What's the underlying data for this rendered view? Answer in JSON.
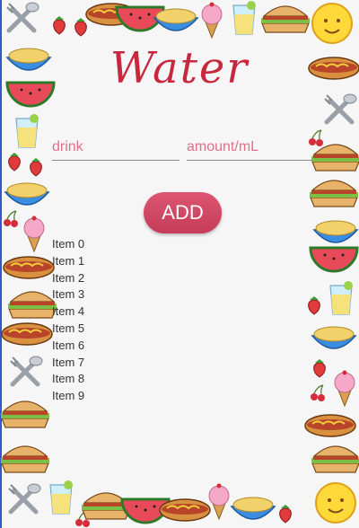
{
  "app": {
    "title": "Water"
  },
  "form": {
    "drink_placeholder": "drink",
    "amount_placeholder": "amount/mL",
    "add_label": "ADD"
  },
  "items": [
    "Item 0",
    "Item 1",
    "Item 2",
    "Item 3",
    "Item 4",
    "Item 5",
    "Item 6",
    "Item 7",
    "Item 8",
    "Item 9"
  ],
  "colors": {
    "accent": "#d24a66",
    "title": "#c8283e",
    "placeholder": "#e0708a",
    "background": "#f6f6f6"
  },
  "decor": {
    "border_icons": [
      "ice-cream-icon",
      "hot-dog-icon",
      "sandwich-icon",
      "watermelon-icon",
      "cereal-bowl-icon",
      "juice-glass-icon",
      "sun-icon",
      "spoon-fork-icon",
      "strawberry-icon",
      "cherry-icon"
    ]
  }
}
